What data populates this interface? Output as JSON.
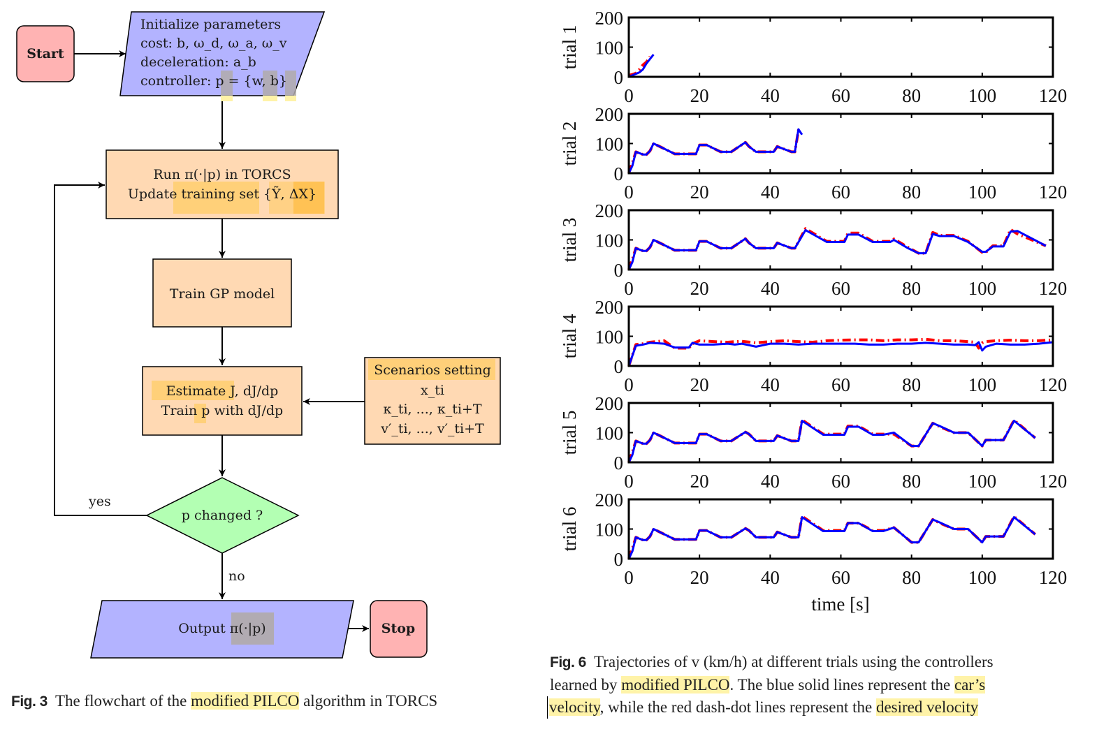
{
  "flowchart": {
    "start": "Start",
    "stop": "Stop",
    "init": {
      "lines": [
        "Initialize parameters",
        "cost: b, ω_d, ω_a, ω_v",
        "deceleration: a_b",
        "controller: p = {w, b}"
      ]
    },
    "run": {
      "lines": [
        "Run π(·|p) in TORCS",
        "Update training set {Ỹ, ΔX}"
      ]
    },
    "train_gp": "Train GP model",
    "estimate": {
      "lines": [
        "Estimate J, dJ/dp",
        "Train p with dJ/dp"
      ]
    },
    "scenarios": {
      "lines": [
        "Scenarios setting",
        "x_ti",
        "κ_ti, ..., κ_ti+T",
        "v′_ti, ..., v′_ti+T"
      ]
    },
    "decision": "p changed ?",
    "yes_label": "yes",
    "no_label": "no",
    "output": "Output π(·|p)",
    "colors": {
      "terminal": "#ffb3b3",
      "io": "#b3b3ff",
      "process": "#ffd9b3",
      "decision": "#b3ffb3",
      "highlight_yellow": "#fff3a8",
      "highlight_orange": "#ffcc66",
      "highlight_gray": "#b0aaaa"
    }
  },
  "captions": {
    "fig3": {
      "label": "Fig. 3",
      "pre": "The flowchart of the ",
      "hl": "modified PILCO",
      "post": " algorithm in TORCS"
    },
    "fig6": {
      "label": "Fig. 6",
      "line1": "Trajectories of v (km/h) at different trials using the controllers",
      "line2_pre": "learned by ",
      "line2_hl": "modified PILCO",
      "line2_mid": ". The blue solid lines represent the ",
      "line2_hl2": "car’s",
      "line3_hl": "velocity",
      "line3_mid": ", while the red dash-dot lines represent the ",
      "line3_hl2": "desired velocity"
    }
  },
  "chart_data": [
    {
      "type": "line",
      "title": "",
      "ylabel": "trial 1",
      "xlabel": "",
      "xlim": [
        0,
        120
      ],
      "ylim": [
        0,
        200
      ],
      "xticks": [
        0,
        20,
        40,
        60,
        80,
        100,
        120
      ],
      "yticks": [
        0,
        100,
        200
      ],
      "series": [
        {
          "name": "desired velocity",
          "style": "red dash-dot",
          "color": "#ff0000",
          "x": [
            0,
            1,
            2,
            3,
            4,
            5,
            6
          ],
          "y": [
            5,
            8,
            12,
            25,
            40,
            50,
            68
          ]
        },
        {
          "name": "car's velocity",
          "style": "blue solid",
          "color": "#0000ff",
          "x": [
            0,
            1,
            2,
            3,
            4,
            5,
            6,
            7
          ],
          "y": [
            0,
            5,
            10,
            15,
            25,
            45,
            60,
            75
          ]
        }
      ]
    },
    {
      "type": "line",
      "title": "",
      "ylabel": "trial 2",
      "xlabel": "",
      "xlim": [
        0,
        120
      ],
      "ylim": [
        0,
        200
      ],
      "xticks": [
        0,
        20,
        40,
        60,
        80,
        100,
        120
      ],
      "yticks": [
        0,
        100,
        200
      ],
      "series": [
        {
          "name": "desired velocity",
          "style": "red dash-dot",
          "color": "#ff0000",
          "x": [
            0,
            1,
            2,
            4,
            5,
            6,
            7,
            13,
            18,
            19,
            20,
            22,
            26,
            28,
            29,
            33,
            34,
            36,
            40,
            41,
            42,
            46,
            47,
            48,
            49
          ],
          "y": [
            0,
            35,
            72,
            63,
            63,
            75,
            100,
            65,
            65,
            65,
            95,
            95,
            72,
            72,
            72,
            104,
            90,
            72,
            72,
            72,
            90,
            72,
            72,
            145,
            140
          ]
        },
        {
          "name": "car's velocity",
          "style": "blue solid",
          "color": "#0000ff",
          "x": [
            0,
            1,
            2,
            4,
            5,
            6,
            7,
            13,
            18,
            19,
            20,
            22,
            26,
            28,
            29,
            33,
            34,
            36,
            40,
            41,
            42,
            46,
            47,
            48,
            49
          ],
          "y": [
            0,
            25,
            72,
            63,
            63,
            75,
            100,
            65,
            65,
            65,
            95,
            95,
            72,
            72,
            72,
            104,
            90,
            72,
            72,
            72,
            90,
            72,
            72,
            148,
            130
          ]
        }
      ]
    },
    {
      "type": "line",
      "title": "",
      "ylabel": "trial 3",
      "xlabel": "",
      "xlim": [
        0,
        120
      ],
      "ylim": [
        0,
        200
      ],
      "xticks": [
        0,
        20,
        40,
        60,
        80,
        100,
        120
      ],
      "yticks": [
        0,
        100,
        200
      ],
      "series": [
        {
          "name": "desired velocity",
          "style": "red dash-dot",
          "color": "#ff0000",
          "x": [
            0,
            1,
            2,
            4,
            5,
            6,
            7,
            13,
            18,
            19,
            20,
            22,
            26,
            28,
            29,
            33,
            34,
            36,
            40,
            41,
            42,
            46,
            47,
            50,
            56,
            60,
            61,
            62,
            65,
            69,
            73,
            74,
            75,
            79,
            82,
            84,
            86,
            88,
            92,
            96,
            100,
            101,
            103,
            106,
            108,
            110,
            118
          ],
          "y": [
            0,
            35,
            72,
            63,
            63,
            75,
            100,
            65,
            65,
            65,
            95,
            95,
            72,
            72,
            72,
            104,
            90,
            72,
            72,
            72,
            90,
            72,
            72,
            138,
            95,
            95,
            95,
            123,
            123,
            95,
            95,
            95,
            103,
            75,
            55,
            55,
            125,
            115,
            115,
            95,
            58,
            58,
            80,
            80,
            135,
            120,
            80
          ]
        },
        {
          "name": "car's velocity",
          "style": "blue solid",
          "color": "#0000ff",
          "x": [
            0,
            1,
            2,
            4,
            5,
            6,
            7,
            13,
            18,
            19,
            20,
            22,
            26,
            28,
            29,
            33,
            34,
            36,
            40,
            41,
            42,
            46,
            47,
            50,
            56,
            60,
            61,
            62,
            65,
            69,
            73,
            74,
            75,
            79,
            82,
            84,
            86,
            88,
            92,
            96,
            100,
            101,
            103,
            106,
            108,
            110,
            118
          ],
          "y": [
            0,
            25,
            72,
            63,
            63,
            75,
            100,
            65,
            65,
            65,
            95,
            95,
            72,
            72,
            72,
            104,
            90,
            72,
            72,
            72,
            90,
            72,
            72,
            133,
            93,
            93,
            93,
            118,
            118,
            93,
            93,
            93,
            100,
            72,
            55,
            55,
            120,
            113,
            113,
            93,
            60,
            60,
            78,
            78,
            128,
            130,
            80
          ]
        }
      ]
    },
    {
      "type": "line",
      "title": "",
      "ylabel": "trial 4",
      "xlabel": "",
      "xlim": [
        0,
        120
      ],
      "ylim": [
        0,
        200
      ],
      "xticks": [
        0,
        20,
        40,
        60,
        80,
        100,
        120
      ],
      "yticks": [
        0,
        100,
        200
      ],
      "series": [
        {
          "name": "desired velocity",
          "style": "red dash-dot",
          "color": "#ff0000",
          "x": [
            0,
            2,
            4,
            6,
            10,
            13,
            17,
            18,
            20,
            24,
            28,
            30,
            32,
            36,
            40,
            44,
            48,
            52,
            56,
            60,
            64,
            68,
            72,
            76,
            80,
            84,
            88,
            92,
            96,
            98,
            99,
            100,
            101,
            104,
            108,
            112,
            116,
            120
          ],
          "y": [
            0,
            72,
            75,
            80,
            85,
            60,
            60,
            75,
            85,
            82,
            80,
            82,
            83,
            78,
            82,
            85,
            82,
            80,
            85,
            87,
            88,
            88,
            85,
            88,
            88,
            90,
            85,
            85,
            82,
            80,
            60,
            78,
            82,
            85,
            87,
            85,
            85,
            88
          ]
        },
        {
          "name": "car's velocity",
          "style": "blue solid",
          "color": "#0000ff",
          "x": [
            0,
            2,
            4,
            6,
            10,
            13,
            17,
            18,
            20,
            24,
            28,
            30,
            32,
            36,
            40,
            44,
            48,
            52,
            56,
            60,
            64,
            68,
            72,
            76,
            80,
            84,
            88,
            92,
            96,
            98,
            99,
            100,
            101,
            104,
            108,
            112,
            116,
            120
          ],
          "y": [
            0,
            68,
            72,
            78,
            75,
            62,
            62,
            78,
            72,
            72,
            75,
            72,
            75,
            65,
            75,
            75,
            72,
            75,
            75,
            75,
            75,
            72,
            72,
            75,
            75,
            78,
            75,
            72,
            72,
            70,
            80,
            52,
            65,
            75,
            72,
            72,
            75,
            80
          ]
        }
      ]
    },
    {
      "type": "line",
      "title": "",
      "ylabel": "trial 5",
      "xlabel": "",
      "xlim": [
        0,
        120
      ],
      "ylim": [
        0,
        200
      ],
      "xticks": [
        0,
        20,
        40,
        60,
        80,
        100,
        120
      ],
      "yticks": [
        0,
        100,
        200
      ],
      "series": [
        {
          "name": "desired velocity",
          "style": "red dash-dot",
          "color": "#ff0000",
          "x": [
            0,
            1,
            2,
            4,
            5,
            6,
            7,
            13,
            18,
            19,
            20,
            22,
            26,
            28,
            29,
            33,
            34,
            36,
            40,
            41,
            42,
            46,
            47,
            48,
            49,
            55,
            60,
            61,
            62,
            65,
            69,
            72,
            75,
            80,
            81,
            82,
            86,
            88,
            92,
            96,
            100,
            101,
            103,
            106,
            109,
            115
          ],
          "y": [
            0,
            35,
            72,
            63,
            63,
            75,
            100,
            65,
            65,
            65,
            95,
            95,
            72,
            72,
            72,
            102,
            95,
            72,
            72,
            72,
            90,
            72,
            72,
            72,
            143,
            95,
            95,
            95,
            122,
            122,
            95,
            95,
            95,
            55,
            55,
            55,
            132,
            120,
            100,
            100,
            55,
            75,
            75,
            75,
            142,
            82
          ]
        },
        {
          "name": "car's velocity",
          "style": "blue solid",
          "color": "#0000ff",
          "x": [
            0,
            1,
            2,
            4,
            5,
            6,
            7,
            13,
            18,
            19,
            20,
            22,
            26,
            28,
            29,
            33,
            34,
            36,
            40,
            41,
            42,
            46,
            47,
            48,
            49,
            55,
            60,
            61,
            62,
            65,
            69,
            72,
            75,
            80,
            81,
            82,
            86,
            88,
            92,
            96,
            100,
            101,
            103,
            106,
            109,
            115
          ],
          "y": [
            0,
            25,
            72,
            63,
            63,
            75,
            100,
            65,
            65,
            65,
            95,
            95,
            72,
            72,
            72,
            102,
            95,
            72,
            72,
            72,
            90,
            72,
            72,
            72,
            140,
            93,
            93,
            93,
            120,
            120,
            93,
            93,
            100,
            55,
            55,
            55,
            132,
            122,
            100,
            100,
            55,
            75,
            75,
            75,
            140,
            82
          ]
        }
      ]
    },
    {
      "type": "line",
      "title": "",
      "ylabel": "trial 6",
      "xlabel": "time [s]",
      "xlim": [
        0,
        120
      ],
      "ylim": [
        0,
        200
      ],
      "xticks": [
        0,
        20,
        40,
        60,
        80,
        100,
        120
      ],
      "yticks": [
        0,
        100,
        200
      ],
      "series": [
        {
          "name": "desired velocity",
          "style": "red dash-dot",
          "color": "#ff0000",
          "x": [
            0,
            1,
            2,
            4,
            5,
            6,
            7,
            13,
            18,
            19,
            20,
            22,
            26,
            28,
            29,
            33,
            34,
            36,
            40,
            41,
            42,
            46,
            47,
            48,
            49,
            55,
            60,
            61,
            62,
            65,
            69,
            72,
            75,
            80,
            81,
            82,
            86,
            88,
            92,
            96,
            100,
            101,
            103,
            106,
            109,
            115
          ],
          "y": [
            0,
            35,
            72,
            63,
            63,
            75,
            100,
            65,
            65,
            65,
            95,
            95,
            72,
            72,
            72,
            102,
            95,
            72,
            72,
            72,
            90,
            72,
            72,
            72,
            143,
            95,
            95,
            95,
            120,
            120,
            95,
            95,
            105,
            55,
            55,
            55,
            132,
            120,
            100,
            100,
            55,
            75,
            75,
            75,
            142,
            82
          ]
        },
        {
          "name": "car's velocity",
          "style": "blue solid",
          "color": "#0000ff",
          "x": [
            0,
            1,
            2,
            4,
            5,
            6,
            7,
            13,
            18,
            19,
            20,
            22,
            26,
            28,
            29,
            33,
            34,
            36,
            40,
            41,
            42,
            46,
            47,
            48,
            49,
            55,
            60,
            61,
            62,
            65,
            69,
            72,
            75,
            80,
            81,
            82,
            86,
            88,
            92,
            96,
            100,
            101,
            103,
            106,
            109,
            115
          ],
          "y": [
            0,
            25,
            72,
            63,
            63,
            75,
            100,
            65,
            65,
            65,
            95,
            95,
            72,
            72,
            72,
            102,
            95,
            72,
            72,
            72,
            90,
            72,
            72,
            72,
            140,
            93,
            93,
            93,
            120,
            120,
            93,
            93,
            105,
            55,
            55,
            55,
            132,
            122,
            100,
            100,
            55,
            75,
            75,
            75,
            140,
            82
          ]
        }
      ]
    }
  ]
}
